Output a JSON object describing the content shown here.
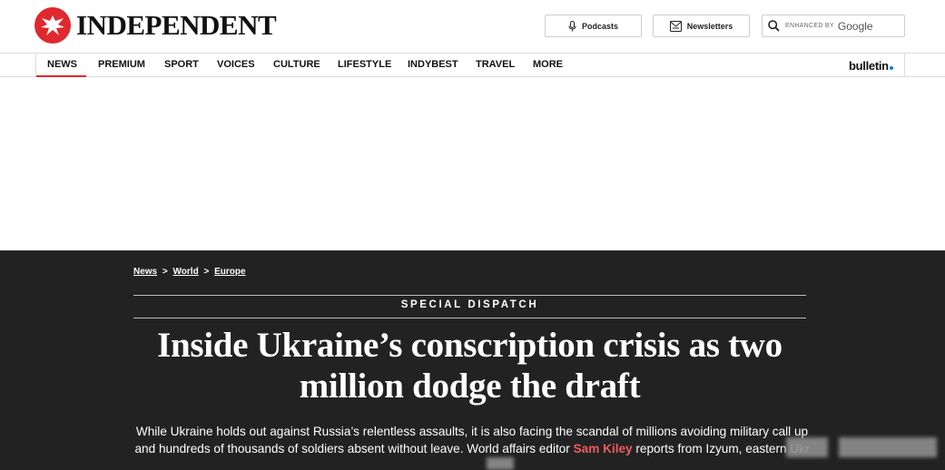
{
  "brand": {
    "name": "INDEPENDENT",
    "color": "#e0282e"
  },
  "header": {
    "podcasts_label": "Podcasts",
    "newsletters_label": "Newsletters",
    "search_label": "ENHANCED BY",
    "search_provider": "Google"
  },
  "nav": {
    "items": [
      "NEWS",
      "PREMIUM",
      "SPORT",
      "VOICES",
      "CULTURE",
      "LIFESTYLE",
      "INDYBEST",
      "TRAVEL",
      "MORE"
    ],
    "active": "NEWS",
    "bulletin": "bulletin"
  },
  "article": {
    "breadcrumb": [
      "News",
      "World",
      "Europe"
    ],
    "breadcrumb_sep": ">",
    "kicker": "SPECIAL DISPATCH",
    "headline": "Inside Ukraine’s conscription crisis as two million dodge the draft",
    "standfirst_before": "While Ukraine holds out against Russia’s relentless assaults, it is also facing the scandal of millions avoiding military call up and hundreds of thousands of soldiers absent without leave. World affairs editor ",
    "author": "Sam Kiley",
    "standfirst_after": " reports from Izyum, eastern Ukr"
  },
  "colors": {
    "accent": "#e0282e",
    "dark_bg": "#222222",
    "author_link": "#f15a5f"
  }
}
